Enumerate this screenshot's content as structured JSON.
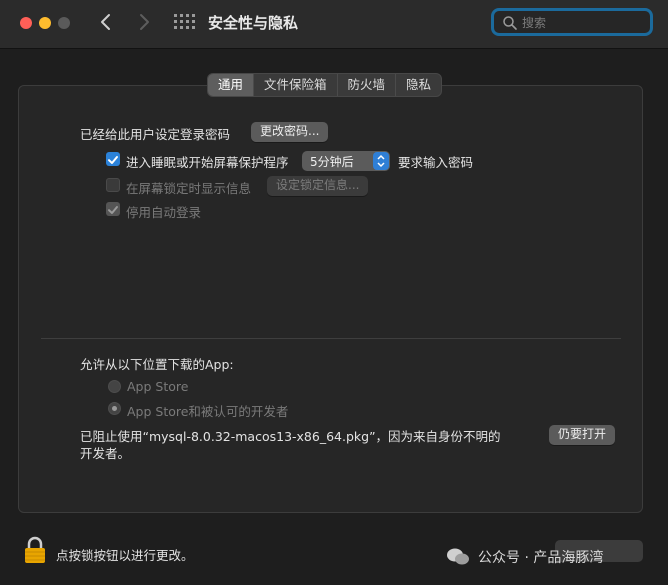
{
  "window": {
    "title": "安全性与隐私"
  },
  "search": {
    "placeholder": "搜索"
  },
  "tabs": [
    {
      "label": "通用",
      "active": true
    },
    {
      "label": "文件保险箱",
      "active": false
    },
    {
      "label": "防火墙",
      "active": false
    },
    {
      "label": "隐私",
      "active": false
    }
  ],
  "general": {
    "password_label": "已经给此用户设定登录密码",
    "change_password_button": "更改密码...",
    "sleep_checkbox": {
      "label": "进入睡眠或开始屏幕保护程序",
      "checked": true
    },
    "sleep_delay": {
      "selected": "5分钟后"
    },
    "require_password_label": "要求输入密码",
    "lock_message_checkbox": {
      "label": "在屏幕锁定时显示信息",
      "checked": false,
      "disabled": true
    },
    "set_lock_message_button": "设定锁定信息...",
    "disable_autologin_checkbox": {
      "label": "停用自动登录",
      "checked": true,
      "disabled": true
    }
  },
  "downloads": {
    "heading": "允许从以下位置下载的App:",
    "options": [
      {
        "label": "App Store",
        "selected": false
      },
      {
        "label": "App Store和被认可的开发者",
        "selected": true
      }
    ],
    "blocked_message_line1": "已阻止使用“mysql-8.0.32-macos13-x86_64.pkg”，因为来自身份不明的",
    "blocked_message_line2": "开发者。",
    "open_anyway_button": "仍要打开"
  },
  "footer": {
    "lock_text": "点按锁按钮以进行更改。",
    "watermark": "公众号 · 产品海豚湾"
  },
  "colors": {
    "accent": "#2b82d9",
    "search_focus": "#1b6a9c",
    "traffic_red": "#ff5f57",
    "traffic_yellow": "#febc2e",
    "lock": "#e8a500"
  }
}
